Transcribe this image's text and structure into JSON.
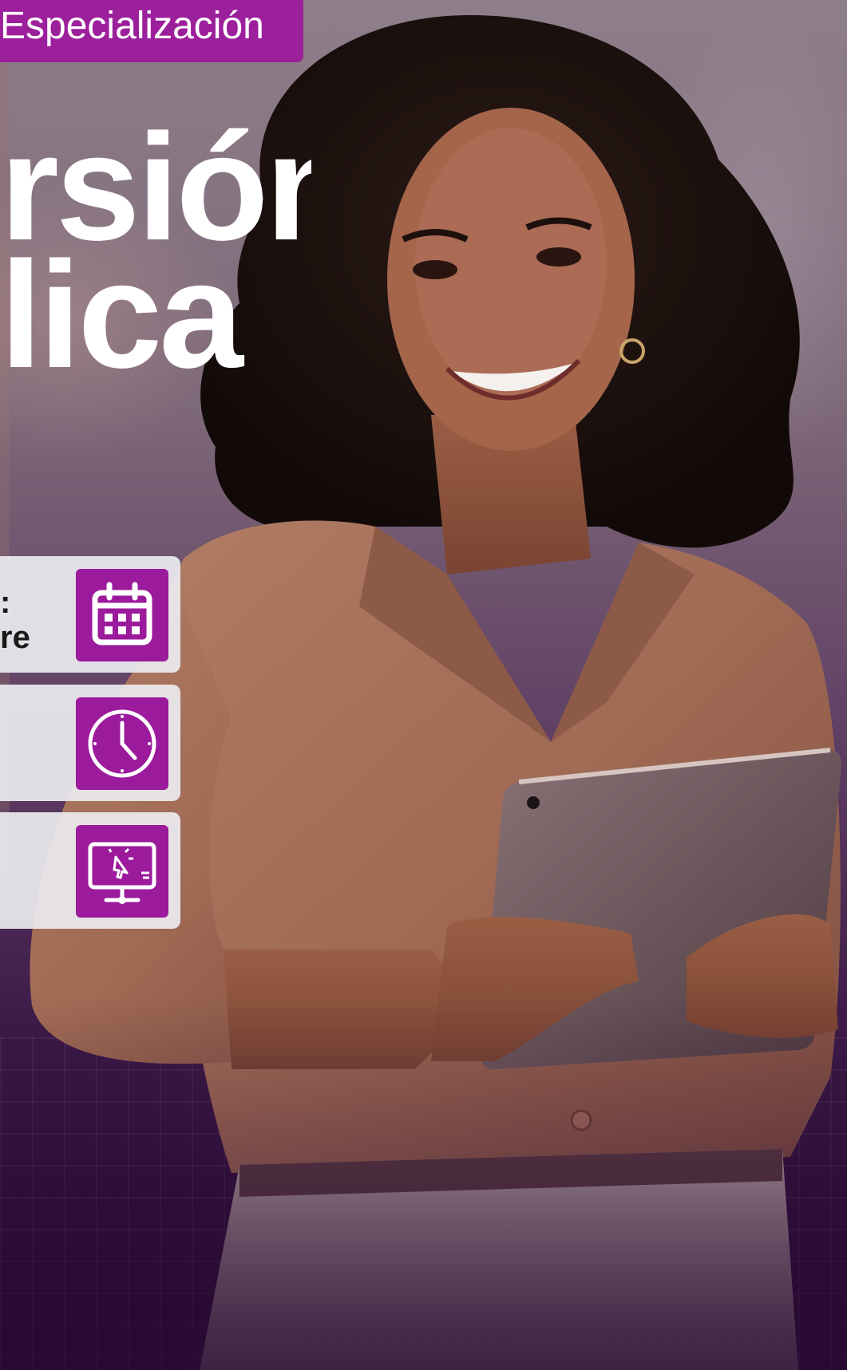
{
  "badge": {
    "label": "Especialización"
  },
  "headline": {
    "line1": "rsión",
    "line2": "lica"
  },
  "info_cards": [
    {
      "text_line1": ":",
      "text_line2": "re",
      "icon": "calendar-icon"
    },
    {
      "text_line1": "",
      "text_line2": "",
      "icon": "clock-icon"
    },
    {
      "text_line1": "",
      "text_line2": "",
      "icon": "monitor-click-icon"
    }
  ],
  "colors": {
    "accent": "#9c1f9c",
    "card_bg": "#ebebf0",
    "deep_purple": "#2b0b36"
  }
}
